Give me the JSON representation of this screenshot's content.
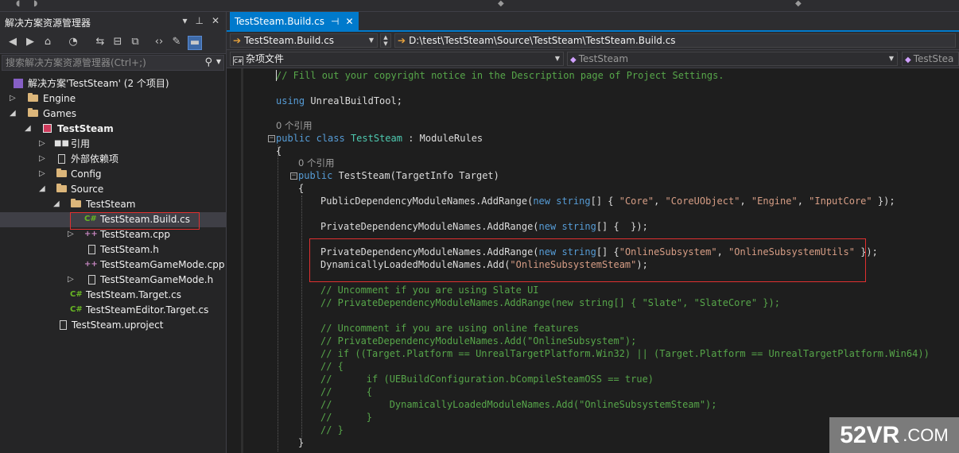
{
  "solution_explorer": {
    "title": "解决方案资源管理器",
    "search_placeholder": "搜索解决方案资源管理器(Ctrl+;)",
    "tree": [
      {
        "label": "解决方案'TestSteam' (2 个项目)",
        "icon": "solution-icon"
      },
      {
        "label": "Engine",
        "icon": "folder-icon"
      },
      {
        "label": "Games",
        "icon": "folder-icon"
      },
      {
        "label": "TestSteam",
        "icon": "project-icon"
      },
      {
        "label": "引用",
        "icon": "references-icon"
      },
      {
        "label": "外部依赖项",
        "icon": "external-deps-icon"
      },
      {
        "label": "Config",
        "icon": "folder-icon"
      },
      {
        "label": "Source",
        "icon": "folder-icon"
      },
      {
        "label": "TestSteam",
        "icon": "folder-icon"
      },
      {
        "label": "TestSteam.Build.cs",
        "icon": "csharp-file-icon"
      },
      {
        "label": "TestSteam.cpp",
        "icon": "cpp-file-icon"
      },
      {
        "label": "TestSteam.h",
        "icon": "header-file-icon"
      },
      {
        "label": "TestSteamGameMode.cpp",
        "icon": "cpp-file-icon"
      },
      {
        "label": "TestSteamGameMode.h",
        "icon": "header-file-icon"
      },
      {
        "label": "TestSteam.Target.cs",
        "icon": "csharp-file-icon"
      },
      {
        "label": "TestSteamEditor.Target.cs",
        "icon": "csharp-file-icon"
      },
      {
        "label": "TestSteam.uproject",
        "icon": "file-icon"
      }
    ]
  },
  "editor": {
    "tab_label": "TestSteam.Build.cs",
    "file_combo": "TestSteam.Build.cs",
    "path_combo": "D:\\test\\TestSteam\\Source\\TestSteam\\TestSteam.Build.cs",
    "scope_combo": "杂项文件",
    "class_combo": "TestSteam",
    "member_combo": "TestStea",
    "refs_label": "0 个引用",
    "code": {
      "l1": "// Fill out your copyright notice in the Description page of Project Settings.",
      "l2_kw": "using",
      "l2_rest": " UnrealBuildTool;",
      "l3_kw1": "public",
      "l3_kw2": "class",
      "l3_ty1": "TestSteam",
      "l3_mid": " : ",
      "l3_ty2": "ModuleRules",
      "l4": "{",
      "l5_kw": "public",
      "l5_rest": " TestSteam(TargetInfo Target)",
      "l6": "{",
      "l7_pre": "PublicDependencyModuleNames.AddRange(",
      "l7_new": "new",
      "l7_str": "string",
      "l7_mid": "[] { ",
      "l7_s1": "\"Core\"",
      "l7_s2": "\"CoreUObject\"",
      "l7_s3": "\"Engine\"",
      "l7_s4": "\"InputCore\"",
      "l7_end": " });",
      "l8_pre": "PrivateDependencyModuleNames.AddRange(",
      "l8_mid": "[] {  });",
      "l9_pre": "PrivateDependencyModuleNames.AddRange(",
      "l9_mid": "[] {",
      "l9_s1": "\"OnlineSubsystem\"",
      "l9_s2": "\"OnlineSubsystemUtils\"",
      "l9_end": " });",
      "l10_pre": "DynamicallyLoadedModuleNames.Add(",
      "l10_s1": "\"OnlineSubsystemSteam\"",
      "l10_end": ");",
      "c1": "// Uncomment if you are using Slate UI",
      "c2": "// PrivateDependencyModuleNames.AddRange(new string[] { \"Slate\", \"SlateCore\" });",
      "c3": "// Uncomment if you are using online features",
      "c4": "// PrivateDependencyModuleNames.Add(\"OnlineSubsystem\");",
      "c5": "// if ((Target.Platform == UnrealTargetPlatform.Win32) || (Target.Platform == UnrealTargetPlatform.Win64))",
      "c6": "// {",
      "c7": "//      if (UEBuildConfiguration.bCompileSteamOSS == true)",
      "c8": "//      {",
      "c9": "//          DynamicallyLoadedModuleNames.Add(\"OnlineSubsystemSteam\");",
      "c10": "//      }",
      "c11": "// }",
      "l_close": "}"
    }
  },
  "watermark": {
    "big": "52VR",
    "small": ".COM"
  }
}
